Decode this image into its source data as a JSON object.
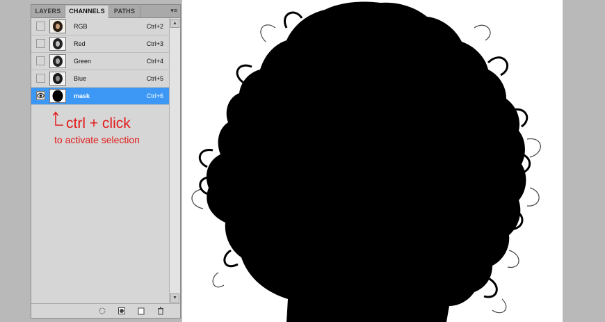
{
  "panel": {
    "tabs": [
      {
        "label": "LAYERS",
        "active": false
      },
      {
        "label": "CHANNELS",
        "active": true
      },
      {
        "label": "PATHS",
        "active": false
      }
    ],
    "menu_icon": "panel-menu-icon",
    "channels": [
      {
        "name": "RGB",
        "shortcut": "Ctrl+2",
        "visible": false,
        "selected": false,
        "thumb": "portrait"
      },
      {
        "name": "Red",
        "shortcut": "Ctrl+3",
        "visible": false,
        "selected": false,
        "thumb": "portrait-gray"
      },
      {
        "name": "Green",
        "shortcut": "Ctrl+4",
        "visible": false,
        "selected": false,
        "thumb": "portrait-gray"
      },
      {
        "name": "Blue",
        "shortcut": "Ctrl+5",
        "visible": false,
        "selected": false,
        "thumb": "portrait-gray"
      },
      {
        "name": "mask",
        "shortcut": "Ctrl+6",
        "visible": true,
        "selected": true,
        "thumb": "mask"
      }
    ],
    "bottom_icons": [
      "load-selection-icon",
      "save-selection-icon",
      "new-channel-icon",
      "delete-channel-icon"
    ]
  },
  "annotation": {
    "main": "ctrl + click",
    "sub": "to activate selection"
  },
  "colors": {
    "selected_row": "#3c98f4",
    "annotation": "#e21a1a",
    "workspace": "#b9b9b9"
  }
}
